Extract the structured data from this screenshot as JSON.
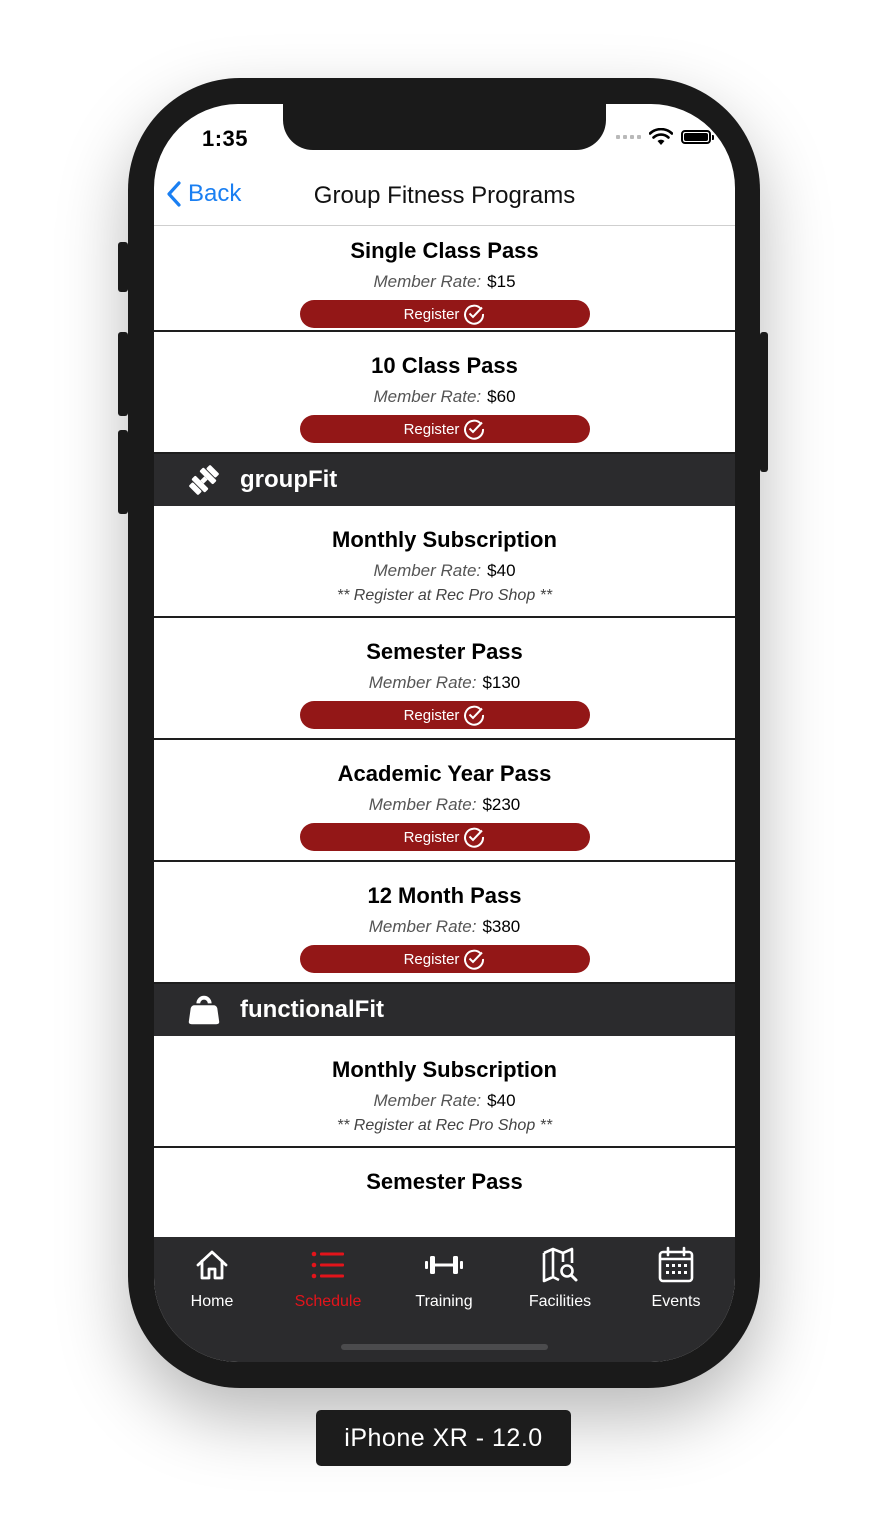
{
  "status_bar": {
    "time": "1:35"
  },
  "navbar": {
    "back_label": "Back",
    "title": "Group Fitness Programs"
  },
  "passes_top": [
    {
      "title": "Single Class Pass",
      "rate_label": "Member Rate:",
      "price": "$15",
      "button": "Register"
    },
    {
      "title": "10 Class Pass",
      "rate_label": "Member Rate:",
      "price": "$60",
      "button": "Register"
    }
  ],
  "sections": [
    {
      "name": "groupFit",
      "icon": "dumbbell-icon",
      "items": [
        {
          "title": "Monthly Subscription",
          "rate_label": "Member Rate:",
          "price": "$40",
          "note": "** Register at Rec Pro Shop **"
        },
        {
          "title": "Semester Pass",
          "rate_label": "Member Rate:",
          "price": "$130",
          "button": "Register"
        },
        {
          "title": "Academic Year Pass",
          "rate_label": "Member Rate:",
          "price": "$230",
          "button": "Register"
        },
        {
          "title": "12 Month Pass",
          "rate_label": "Member Rate:",
          "price": "$380",
          "button": "Register"
        }
      ]
    },
    {
      "name": "functionalFit",
      "icon": "kettlebell-icon",
      "items": [
        {
          "title": "Monthly Subscription",
          "rate_label": "Member Rate:",
          "price": "$40",
          "note": "** Register at Rec Pro Shop **"
        },
        {
          "title": "Semester Pass"
        }
      ]
    }
  ],
  "tabbar": {
    "tabs": [
      {
        "label": "Home",
        "icon": "home-icon"
      },
      {
        "label": "Schedule",
        "icon": "list-icon",
        "active": true
      },
      {
        "label": "Training",
        "icon": "barbell-icon"
      },
      {
        "label": "Facilities",
        "icon": "map-search-icon"
      },
      {
        "label": "Events",
        "icon": "calendar-icon"
      }
    ]
  },
  "colors": {
    "accent": "#931717",
    "active_tab": "#e3141b",
    "link": "#1a7ff2",
    "bar_bg": "#2b2b2d"
  },
  "device_label": "iPhone XR - 12.0"
}
